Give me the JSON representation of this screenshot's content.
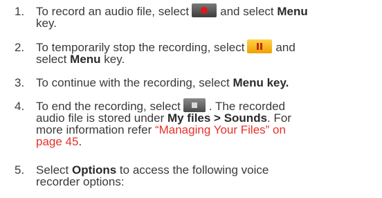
{
  "steps": [
    {
      "number": "1.",
      "line1_pre": "To record an audio file, select",
      "icon": "record-icon",
      "line1_post": "and select",
      "line1_bold": "Menu",
      "line2": "key."
    },
    {
      "number": "2.",
      "line1_pre": "To temporarily stop the recording, select",
      "icon": "pause-icon",
      "line1_post": "and",
      "line2_pre": "select",
      "line2_bold": "Menu",
      "line2_post": " key."
    },
    {
      "number": "3.",
      "pre": "To continue with the recording, select",
      "bold": "Menu",
      "post": " key."
    },
    {
      "number": "4.",
      "line1_pre": "To end the recording, select",
      "icon": "stop-icon",
      "line1_post": ". The recorded",
      "line2_pre": "audio file is stored under",
      "line2_bold": "My files > Sounds",
      "line2_post": ". For",
      "line3_pre": "more information refer ",
      "link_part1": "“Managing Your Files” on",
      "link_part2": "page 45",
      "line4_post": "."
    },
    {
      "number": "5.",
      "line1_pre": "Select",
      "line1_bold": "Options",
      "line1_post": " to access the following voice",
      "line2": "recorder options:"
    }
  ],
  "colors": {
    "text": "#3a3a3a",
    "link": "#e8302a",
    "record_dot": "#e01818",
    "pause_bg": "#f0a000"
  }
}
